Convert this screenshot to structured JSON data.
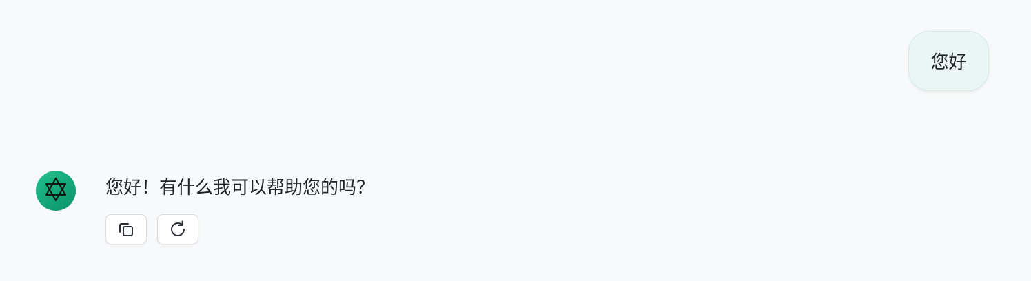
{
  "user_message": {
    "text": "您好",
    "bubble_color": "#ebf5f4"
  },
  "assistant_message": {
    "avatar_icon": "star-of-david-icon",
    "avatar_color": "#16a97a",
    "text": "您好！有什么我可以帮助您的吗？",
    "actions": [
      {
        "name": "copy",
        "icon": "copy-icon"
      },
      {
        "name": "regenerate",
        "icon": "refresh-icon"
      }
    ]
  },
  "colors": {
    "background": "#f8f9fa",
    "text": "#1f2328"
  }
}
